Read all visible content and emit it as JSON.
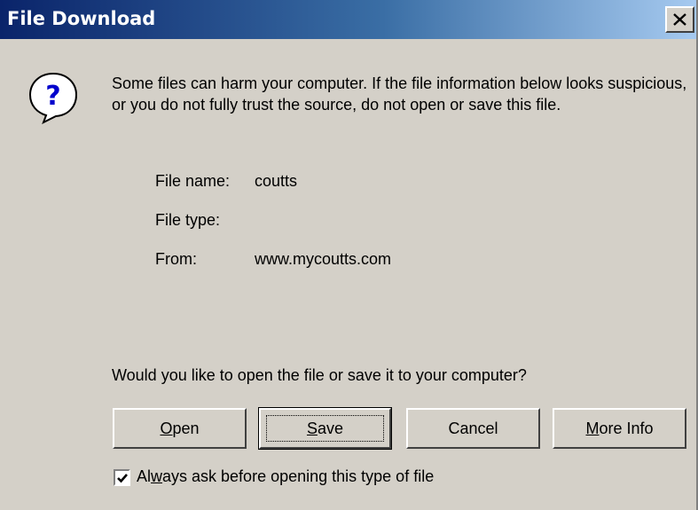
{
  "window": {
    "title": "File Download",
    "close_icon": "close-icon"
  },
  "message": {
    "icon": "question-icon",
    "text": "Some files can harm your computer. If the file information below looks suspicious, or you do not fully trust the source, do not open or save this file."
  },
  "file_info": {
    "name_label": "File name:",
    "name_value": "coutts",
    "type_label": "File type:",
    "type_value": "",
    "from_label": "From:",
    "from_value": "www.mycoutts.com"
  },
  "question": "Would you like to open the file or save it to your computer?",
  "buttons": {
    "open": {
      "mnemonic": "O",
      "rest": "pen"
    },
    "save": {
      "mnemonic": "S",
      "rest": "ave"
    },
    "cancel": {
      "label": "Cancel"
    },
    "more_info": {
      "mnemonic": "M",
      "rest": "ore Info"
    }
  },
  "checkbox": {
    "checked": true,
    "label_before": "Al",
    "label_mnemonic": "w",
    "label_after": "ays ask before opening this type of file"
  },
  "colors": {
    "face": "#d4d0c8",
    "title_start": "#0a246a",
    "title_end": "#a6caf0"
  }
}
